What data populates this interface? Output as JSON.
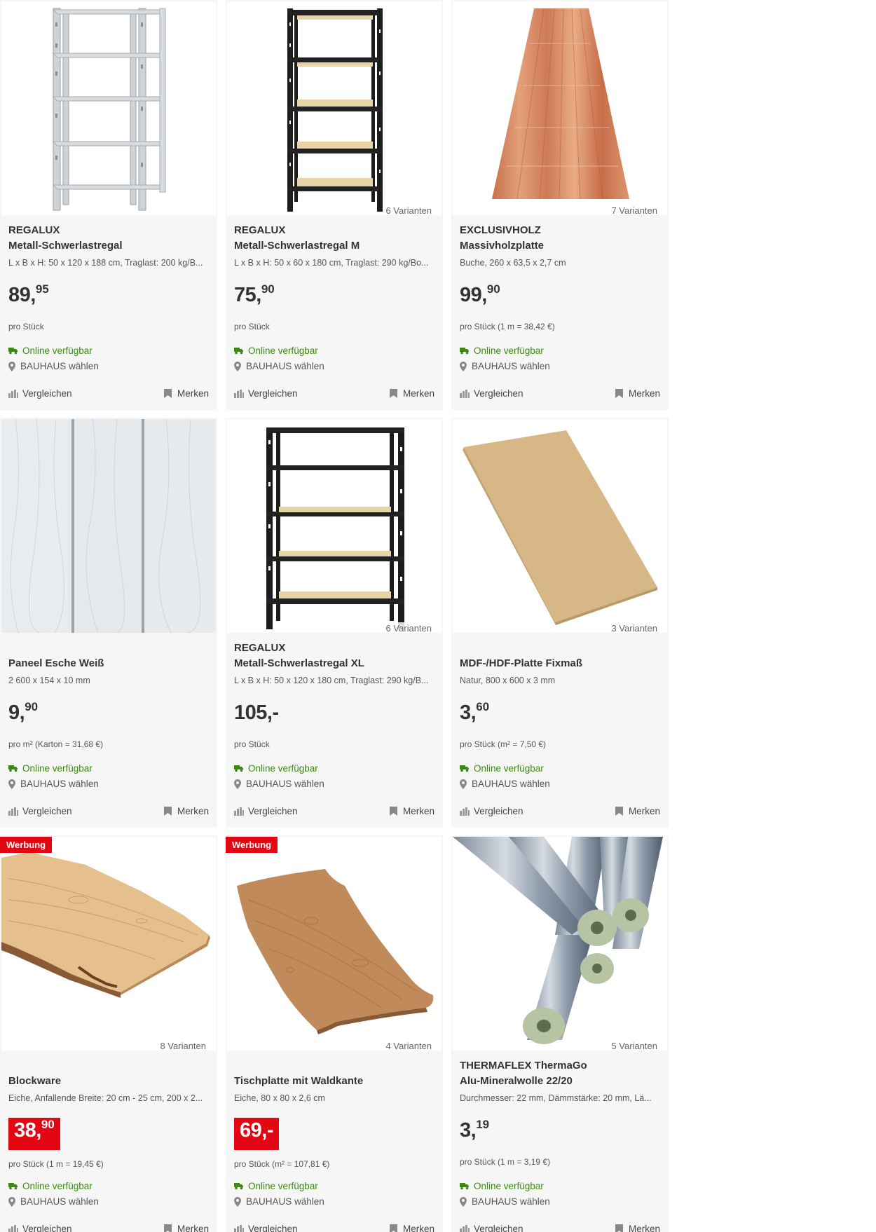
{
  "products": [
    {
      "brand": "REGALUX",
      "name": "Metall-Schwerlastregal",
      "desc": "L x B x H: 50 x 120 x 188 cm, Traglast: 200 kg/B...",
      "price_main": "89,",
      "price_sup": "95",
      "unit": "pro Stück",
      "variants": "",
      "ad": "",
      "availability": "Online verfügbar",
      "store": "BAUHAUS wählen",
      "compare": "Vergleichen",
      "remember": "Merken",
      "image_icon": "shelf-icon"
    },
    {
      "brand": "REGALUX",
      "name": "Metall-Schwerlastregal M",
      "desc": "L x B x H: 50 x 60 x 180 cm, Traglast: 290 kg/Bo...",
      "price_main": "75,",
      "price_sup": "90",
      "unit": "pro Stück",
      "variants": "6 Varianten",
      "ad": "",
      "availability": "Online verfügbar",
      "store": "BAUHAUS wählen",
      "compare": "Vergleichen",
      "remember": "Merken",
      "image_icon": "shelf-icon"
    },
    {
      "brand": "EXCLUSIVHOLZ",
      "name": "Massivholzplatte",
      "desc": "Buche, 260 x 63,5 x 2,7 cm",
      "price_main": "99,",
      "price_sup": "90",
      "unit": "pro Stück (1 m = 38,42 €)",
      "variants": "7 Varianten",
      "ad": "",
      "availability": "Online verfügbar",
      "store": "BAUHAUS wählen",
      "compare": "Vergleichen",
      "remember": "Merken",
      "image_icon": "wood-board-icon"
    },
    {
      "brand": "",
      "name": "Paneel Esche Weiß",
      "desc": "2 600 x 154 x 10 mm",
      "price_main": "9,",
      "price_sup": "90",
      "unit": "pro m² (Karton = 31,68 €)",
      "variants": "",
      "ad": "",
      "availability": "Online verfügbar",
      "store": "BAUHAUS wählen",
      "compare": "Vergleichen",
      "remember": "Merken",
      "image_icon": "panel-icon"
    },
    {
      "brand": "REGALUX",
      "name": "Metall-Schwerlastregal XL",
      "desc": "L x B x H: 50 x 120 x 180 cm, Traglast: 290 kg/B...",
      "price_main": "105,-",
      "price_sup": "",
      "unit": "pro Stück",
      "variants": "6 Varianten",
      "ad": "",
      "availability": "Online verfügbar",
      "store": "BAUHAUS wählen",
      "compare": "Vergleichen",
      "remember": "Merken",
      "image_icon": "shelf-icon"
    },
    {
      "brand": "",
      "name": "MDF-/HDF-Platte Fixmaß",
      "desc": "Natur, 800 x 600 x 3 mm",
      "price_main": "3,",
      "price_sup": "60",
      "unit": "pro Stück (m² = 7,50 €)",
      "variants": "3 Varianten",
      "ad": "",
      "availability": "Online verfügbar",
      "store": "BAUHAUS wählen",
      "compare": "Vergleichen",
      "remember": "Merken",
      "image_icon": "mdf-board-icon"
    },
    {
      "brand": "",
      "name": "Blockware",
      "desc": "Eiche, Anfallende Breite: 20 cm - 25 cm, 200 x 2...",
      "price_main": "38,",
      "price_sup": "90",
      "unit": "pro Stück (1 m = 19,45 €)",
      "variants": "8 Varianten",
      "ad": "Werbung",
      "availability": "Online verfügbar",
      "store": "BAUHAUS wählen",
      "compare": "Vergleichen",
      "remember": "Merken",
      "image_icon": "live-edge-plank-icon"
    },
    {
      "brand": "",
      "name": "Tischplatte mit Waldkante",
      "desc": "Eiche, 80 x 80 x 2,6 cm",
      "price_main": "69,-",
      "price_sup": "",
      "unit": "pro Stück (m² = 107,81 €)",
      "variants": "4 Varianten",
      "ad": "Werbung",
      "availability": "Online verfügbar",
      "store": "BAUHAUS wählen",
      "compare": "Vergleichen",
      "remember": "Merken",
      "image_icon": "tabletop-icon"
    },
    {
      "brand": "THERMAFLEX ThermaGo",
      "name": "Alu-Mineralwolle 22/20",
      "desc": "Durchmesser: 22 mm, Dämmstärke: 20 mm, Lä...",
      "price_main": "3,",
      "price_sup": "19",
      "unit": "pro Stück (1 m = 3,19 €)",
      "variants": "5 Varianten",
      "ad": "",
      "availability": "Online verfügbar",
      "store": "BAUHAUS wählen",
      "compare": "Vergleichen",
      "remember": "Merken",
      "image_icon": "insulation-pipe-icon"
    }
  ],
  "colors": {
    "accent_red": "#e30613",
    "available_green": "#3a8a0f",
    "card_bg": "#f6f6f6"
  }
}
